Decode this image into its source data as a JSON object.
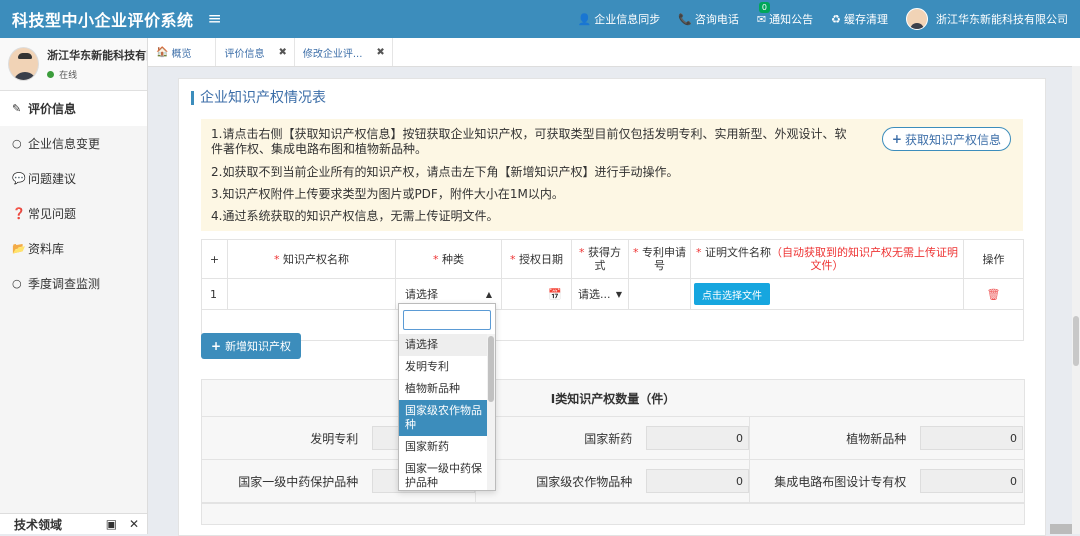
{
  "app": {
    "title": "科技型中小企业评价系统",
    "menu_icon": "hamburger-icon",
    "colors": {
      "header": "#3c8dbc",
      "accent": "#3c8dbc",
      "required": "#e33333",
      "button_cyan": "#16a6df"
    }
  },
  "topbar": {
    "actions": [
      {
        "icon": "person-icon",
        "label": "企业信息同步"
      },
      {
        "icon": "phone-icon",
        "label": "咨询电话"
      },
      {
        "icon": "mail-icon",
        "label": "通知公告",
        "badge": "0"
      },
      {
        "icon": "recycle-icon",
        "label": "缓存清理"
      }
    ],
    "user_name": "浙江华东新能科技有限公司"
  },
  "sidebar": {
    "user_name": "浙江华东新能科技有限",
    "status": "在线",
    "items": [
      {
        "icon": "edit-icon",
        "label": "评价信息",
        "active": true
      },
      {
        "icon": "circle-icon",
        "label": "企业信息变更"
      },
      {
        "icon": "chat-icon",
        "label": "问题建议"
      },
      {
        "icon": "question-icon",
        "label": "常见问题"
      },
      {
        "icon": "folder-icon",
        "label": "资料库"
      },
      {
        "icon": "circle-icon",
        "label": "季度调查监测"
      }
    ],
    "bottom_panel": {
      "label": "技术领域"
    }
  },
  "tabs": [
    {
      "icon": "home-icon",
      "label": "概览"
    },
    {
      "label": "评价信息",
      "closable": true
    },
    {
      "label": "修改企业评...",
      "closable": true
    }
  ],
  "section": {
    "title": "企业知识产权情况表",
    "notes": [
      "1.请点击右侧【获取知识产权信息】按钮获取企业知识产权，可获取类型目前仅包括发明专利、实用新型、外观设计、软件著作权、集成电路布图和植物新品种。",
      "2.如获取不到当前企业所有的知识产权，请点击左下角【新增知识产权】进行手动操作。",
      "3.知识产权附件上传要求类型为图片或PDF，附件大小在1M以内。",
      "4.通过系统获取的知识产权信息，无需上传证明文件。"
    ],
    "fetch_button": "获取知识产权信息"
  },
  "ip_table": {
    "add_icon": "+",
    "columns": {
      "name": "知识产权名称",
      "type": "种类",
      "grant_date": "授权日期",
      "acquire": "获得方式",
      "patent_no": "专利申请号",
      "cert": "证明文件名称",
      "cert_note": "（自动获取到的知识产权无需上传证明文件）",
      "op": "操作"
    },
    "rows": [
      {
        "index": "1",
        "type_value": "请选择",
        "acquire_value": "请选...",
        "file_button": "点击选择文件"
      }
    ]
  },
  "add_button": "新增知识产权",
  "dropdown": {
    "options": [
      "请选择",
      "发明专利",
      "植物新品种",
      "国家级农作物品种",
      "国家新药",
      "国家一级中药保护品种"
    ],
    "selected_index": 3
  },
  "counts": {
    "title": "I类知识产权数量（件）",
    "rows": [
      [
        {
          "label": "发明专利",
          "value": ""
        },
        {
          "label": "国家新药",
          "value": "0"
        },
        {
          "label": "植物新品种",
          "value": "0"
        }
      ],
      [
        {
          "label": "国家一级中药保护品种",
          "value": ""
        },
        {
          "label": "国家级农作物品种",
          "value": "0"
        },
        {
          "label": "集成电路布图设计专有权",
          "value": "0"
        }
      ]
    ]
  }
}
